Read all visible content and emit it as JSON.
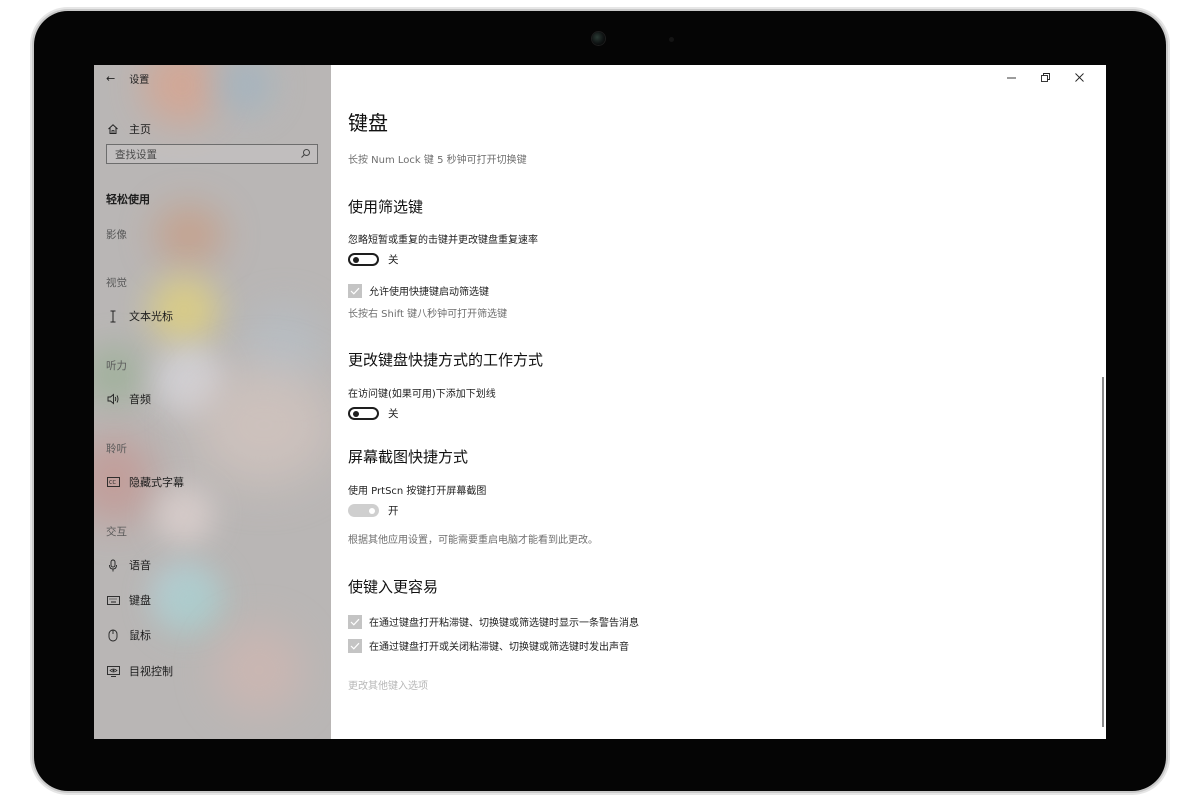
{
  "sidebar": {
    "back_title": "设置",
    "home_label": "主页",
    "search_placeholder": "查找设置",
    "category": "轻松使用",
    "sections": [
      {
        "label": "影像"
      },
      {
        "label": "视觉"
      },
      {
        "label": "听力"
      },
      {
        "label": "聆听"
      },
      {
        "label": "交互"
      }
    ],
    "items": [
      {
        "label": "文本光标",
        "icon": "text-cursor-icon"
      },
      {
        "label": "音频",
        "icon": "speaker-icon"
      },
      {
        "label": "隐藏式字幕",
        "icon": "closed-captions-icon"
      },
      {
        "label": "语音",
        "icon": "microphone-icon"
      },
      {
        "label": "键盘",
        "icon": "keyboard-icon"
      },
      {
        "label": "鼠标",
        "icon": "mouse-icon"
      },
      {
        "label": "目视控制",
        "icon": "eye-control-icon"
      }
    ]
  },
  "main": {
    "title": "键盘",
    "numlock_note": "长按 Num Lock 键 5 秒钟可打开切换键",
    "filter_keys": {
      "heading": "使用筛选键",
      "toggle_desc": "忽略短暂或重复的击键并更改键盘重复速率",
      "toggle_state": "关",
      "checkbox_label": "允许使用快捷键启动筛选键",
      "shortcut_note": "长按右 Shift 键八秒钟可打开筛选键"
    },
    "shortcuts": {
      "heading": "更改键盘快捷方式的工作方式",
      "toggle_desc": "在访问键(如果可用)下添加下划线",
      "toggle_state": "关"
    },
    "screenshot": {
      "heading": "屏幕截图快捷方式",
      "toggle_desc": "使用 PrtScn 按键打开屏幕截图",
      "toggle_state": "开",
      "note": "根据其他应用设置，可能需要重启电脑才能看到此更改。"
    },
    "typing": {
      "heading": "使键入更容易",
      "check1": "在通过键盘打开粘滞键、切换键或筛选键时显示一条警告消息",
      "check2": "在通过键盘打开或关闭粘滞键、切换键或筛选键时发出声音",
      "link": "更改其他键入选项"
    }
  }
}
